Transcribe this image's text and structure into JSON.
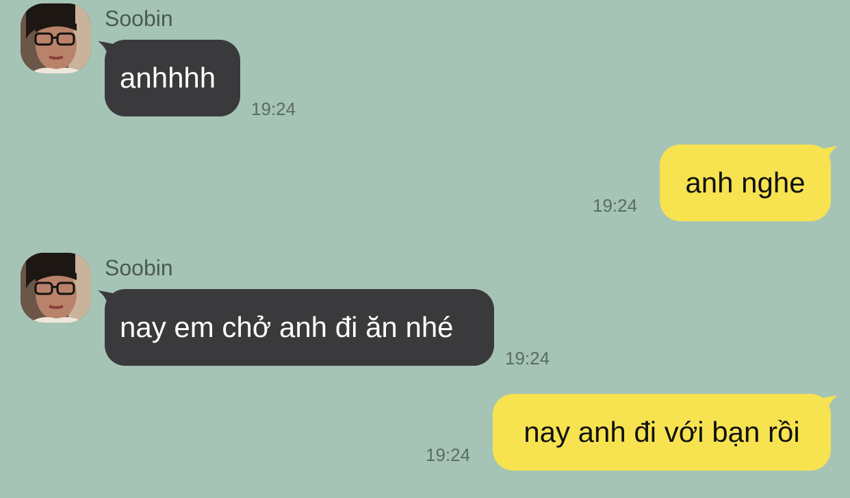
{
  "colors": {
    "background": "#a5c4b6",
    "incoming_bubble": "#3a3a3c",
    "outgoing_bubble": "#f7e34f",
    "timestamp": "#5b6b63",
    "sender_name": "#4a5a52"
  },
  "messages": [
    {
      "direction": "incoming",
      "sender": "Soobin",
      "text": "anhhhh",
      "time": "19:24",
      "avatar_icon": "contact-avatar"
    },
    {
      "direction": "outgoing",
      "text": "anh nghe",
      "time": "19:24"
    },
    {
      "direction": "incoming",
      "sender": "Soobin",
      "text": "nay em chở anh đi ăn nhé",
      "time": "19:24",
      "avatar_icon": "contact-avatar"
    },
    {
      "direction": "outgoing",
      "text": "nay anh đi với bạn rồi",
      "time": "19:24"
    }
  ]
}
